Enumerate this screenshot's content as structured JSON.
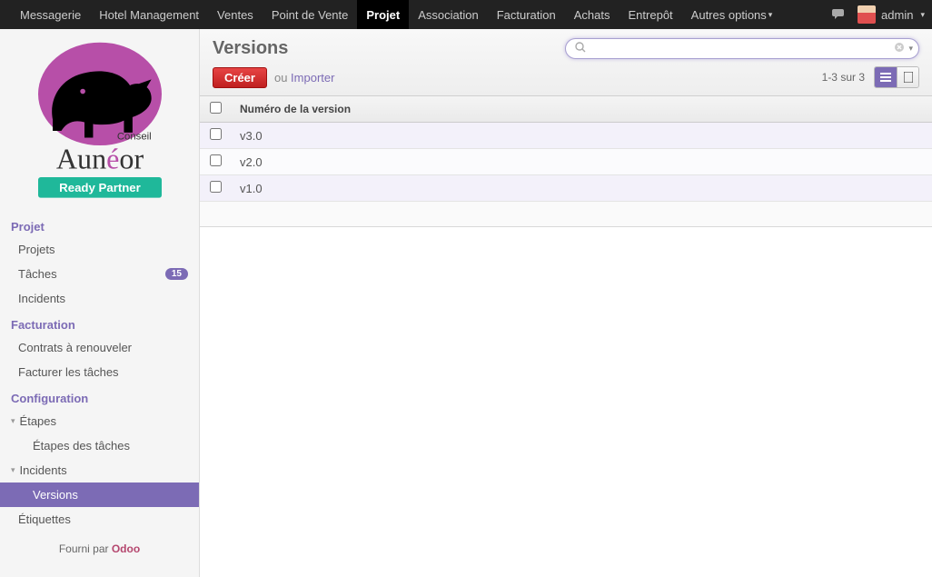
{
  "nav": {
    "items": [
      {
        "label": "Messagerie"
      },
      {
        "label": "Hotel Management"
      },
      {
        "label": "Ventes"
      },
      {
        "label": "Point de Vente"
      },
      {
        "label": "Projet",
        "active": true
      },
      {
        "label": "Association"
      },
      {
        "label": "Facturation"
      },
      {
        "label": "Achats"
      },
      {
        "label": "Entrepôt"
      },
      {
        "label": "Autres options"
      }
    ],
    "user": "admin"
  },
  "sidebar": {
    "sections": [
      {
        "title": "Projet",
        "items": [
          {
            "label": "Projets"
          },
          {
            "label": "Tâches",
            "badge": "15"
          },
          {
            "label": "Incidents"
          }
        ]
      },
      {
        "title": "Facturation",
        "items": [
          {
            "label": "Contrats à renouveler"
          },
          {
            "label": "Facturer les tâches"
          }
        ]
      },
      {
        "title": "Configuration",
        "expandables": [
          {
            "label": "Étapes",
            "subs": [
              {
                "label": "Étapes des tâches"
              }
            ]
          },
          {
            "label": "Incidents",
            "subs": [
              {
                "label": "Versions",
                "active": true
              }
            ]
          }
        ],
        "items": [
          {
            "label": "Étiquettes"
          }
        ]
      }
    ],
    "powered_prefix": "Fourni par ",
    "powered_brand": "Odoo"
  },
  "page": {
    "title": "Versions",
    "search_placeholder": "",
    "create_label": "Créer",
    "or_text": "ou ",
    "import_label": "Importer",
    "pager": "1-3 sur 3"
  },
  "table": {
    "header": "Numéro de la version",
    "rows": [
      {
        "name": "v3.0"
      },
      {
        "name": "v2.0"
      },
      {
        "name": "v1.0"
      }
    ]
  }
}
